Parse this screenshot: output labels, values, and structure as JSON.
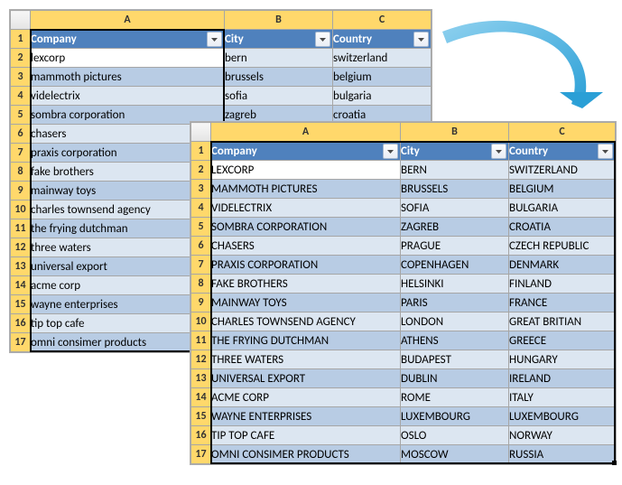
{
  "columns": {
    "A": "A",
    "B": "B",
    "C": "C"
  },
  "headers": {
    "company": "Company",
    "city": "City",
    "country": "Country"
  },
  "table_left": {
    "col_widths": {
      "row": 22,
      "A": 215,
      "B": 120,
      "C": 109
    },
    "rows": [
      {
        "n": "1"
      },
      {
        "n": "2",
        "company": "lexcorp",
        "city": "bern",
        "country": "switzerland"
      },
      {
        "n": "3",
        "company": "mammoth pictures",
        "city": "brussels",
        "country": "belgium"
      },
      {
        "n": "4",
        "company": "videlectrix",
        "city": "sofia",
        "country": "bulgaria"
      },
      {
        "n": "5",
        "company": "sombra corporation",
        "city": "zagreb",
        "country": "croatia"
      },
      {
        "n": "6",
        "company": "chasers",
        "city": "",
        "country": ""
      },
      {
        "n": "7",
        "company": "praxis corporation",
        "city": "",
        "country": ""
      },
      {
        "n": "8",
        "company": "fake brothers",
        "city": "",
        "country": ""
      },
      {
        "n": "9",
        "company": "mainway toys",
        "city": "",
        "country": ""
      },
      {
        "n": "10",
        "company": "charles townsend agency",
        "city": "",
        "country": ""
      },
      {
        "n": "11",
        "company": "the frying dutchman",
        "city": "",
        "country": ""
      },
      {
        "n": "12",
        "company": "three waters",
        "city": "",
        "country": ""
      },
      {
        "n": "13",
        "company": "universal export",
        "city": "",
        "country": ""
      },
      {
        "n": "14",
        "company": "acme corp",
        "city": "",
        "country": ""
      },
      {
        "n": "15",
        "company": "wayne enterprises",
        "city": "",
        "country": ""
      },
      {
        "n": "16",
        "company": "tip top cafe",
        "city": "",
        "country": ""
      },
      {
        "n": "17",
        "company": "omni consimer products",
        "city": "",
        "country": ""
      }
    ]
  },
  "table_right": {
    "col_widths": {
      "row": 22,
      "A": 210,
      "B": 120,
      "C": 118
    },
    "rows": [
      {
        "n": "1"
      },
      {
        "n": "2",
        "company": "LEXCORP",
        "city": "BERN",
        "country": "SWITZERLAND"
      },
      {
        "n": "3",
        "company": "MAMMOTH PICTURES",
        "city": "BRUSSELS",
        "country": "BELGIUM"
      },
      {
        "n": "4",
        "company": "VIDELECTRIX",
        "city": "SOFIA",
        "country": "BULGARIA"
      },
      {
        "n": "5",
        "company": "SOMBRA CORPORATION",
        "city": "ZAGREB",
        "country": "CROATIA"
      },
      {
        "n": "6",
        "company": "CHASERS",
        "city": "PRAGUE",
        "country": "CZECH REPUBLIC"
      },
      {
        "n": "7",
        "company": "PRAXIS CORPORATION",
        "city": "COPENHAGEN",
        "country": "DENMARK"
      },
      {
        "n": "8",
        "company": "FAKE BROTHERS",
        "city": "HELSINKI",
        "country": "FINLAND"
      },
      {
        "n": "9",
        "company": "MAINWAY TOYS",
        "city": "PARIS",
        "country": "FRANCE"
      },
      {
        "n": "10",
        "company": "CHARLES TOWNSEND AGENCY",
        "city": "LONDON",
        "country": "GREAT BRITIAN"
      },
      {
        "n": "11",
        "company": "THE FRYING DUTCHMAN",
        "city": "ATHENS",
        "country": "GREECE"
      },
      {
        "n": "12",
        "company": "THREE WATERS",
        "city": "BUDAPEST",
        "country": "HUNGARY"
      },
      {
        "n": "13",
        "company": "UNIVERSAL EXPORT",
        "city": "DUBLIN",
        "country": "IRELAND"
      },
      {
        "n": "14",
        "company": "ACME CORP",
        "city": "ROME",
        "country": "ITALY"
      },
      {
        "n": "15",
        "company": "WAYNE ENTERPRISES",
        "city": "LUXEMBOURG",
        "country": "LUXEMBOURG"
      },
      {
        "n": "16",
        "company": "TIP TOP CAFE",
        "city": "OSLO",
        "country": "NORWAY"
      },
      {
        "n": "17",
        "company": "OMNI CONSIMER PRODUCTS",
        "city": "MOSCOW",
        "country": "RUSSIA"
      }
    ]
  }
}
